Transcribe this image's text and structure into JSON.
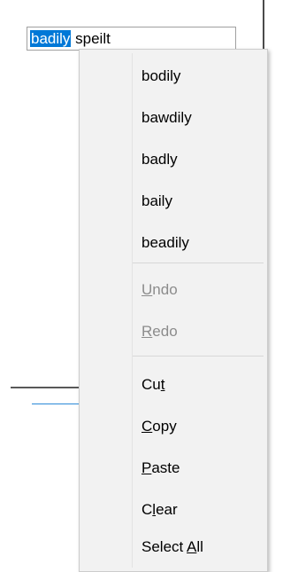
{
  "textbox": {
    "selected_word": "badily",
    "rest": " speilt"
  },
  "menu": {
    "suggestions": [
      "bodily",
      "bawdily",
      "badly",
      "baily",
      "beadily"
    ],
    "undo": {
      "pre": "",
      "key": "U",
      "post": "ndo"
    },
    "redo": {
      "pre": "",
      "key": "R",
      "post": "edo"
    },
    "cut": {
      "pre": "Cu",
      "key": "t",
      "post": ""
    },
    "copy": {
      "pre": "",
      "key": "C",
      "post": "opy"
    },
    "paste": {
      "pre": "",
      "key": "P",
      "post": "aste"
    },
    "clear": {
      "pre": "C",
      "key": "l",
      "post": "ear"
    },
    "select_all": {
      "pre": "Select ",
      "key": "A",
      "post": "ll"
    }
  },
  "colors": {
    "selection": "#0078d7",
    "menu_bg": "#f2f2f2",
    "disabled_text": "#8c8c8c"
  }
}
